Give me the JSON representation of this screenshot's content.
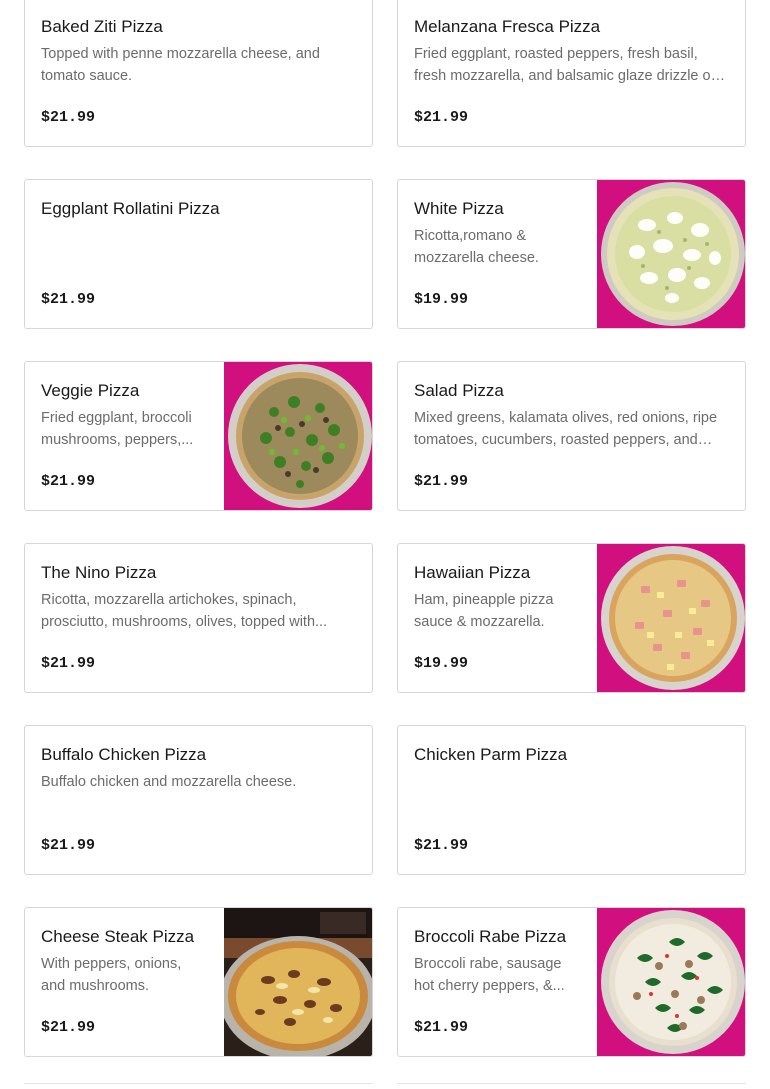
{
  "menu": {
    "items": [
      {
        "name": "Baked Ziti Pizza",
        "description": "Topped with penne mozzarella cheese, and tomato sauce.",
        "price": "$21.99",
        "image": null
      },
      {
        "name": "Melanzana Fresca Pizza",
        "description": "Fried eggplant, roasted peppers, fresh basil, fresh mozzarella, and balsamic glaze drizzle on a whi...",
        "price": "$21.99",
        "image": null
      },
      {
        "name": "Eggplant Rollatini Pizza",
        "description": "",
        "price": "$21.99",
        "image": null
      },
      {
        "name": "White Pizza",
        "description": "Ricotta,romano & mozzarella cheese.",
        "price": "$19.99",
        "image": "white-pizza"
      },
      {
        "name": "Veggie Pizza",
        "description": "Fried eggplant, broccoli mushrooms, peppers,...",
        "price": "$21.99",
        "image": "veggie-pizza"
      },
      {
        "name": "Salad Pizza",
        "description": "Mixed greens, kalamata olives, red onions, ripe tomatoes, cucumbers, roasted peppers, and fre...",
        "price": "$21.99",
        "image": null
      },
      {
        "name": "The Nino Pizza",
        "description": "Ricotta, mozzarella artichokes, spinach, prosciutto, mushrooms, olives, topped with...",
        "price": "$21.99",
        "image": null
      },
      {
        "name": "Hawaiian Pizza",
        "description": "Ham, pineapple pizza sauce & mozzarella.",
        "price": "$19.99",
        "image": "hawaiian-pizza"
      },
      {
        "name": "Buffalo Chicken Pizza",
        "description": "Buffalo chicken and mozzarella cheese.",
        "price": "$21.99",
        "image": null
      },
      {
        "name": "Chicken Parm Pizza",
        "description": "",
        "price": "$21.99",
        "image": null
      },
      {
        "name": "Cheese Steak Pizza",
        "description": "With peppers, onions, and mushrooms.",
        "price": "$21.99",
        "image": "cheese-steak-pizza"
      },
      {
        "name": "Broccoli Rabe Pizza",
        "description": "Broccoli rabe, sausage hot cherry peppers, &...",
        "price": "$21.99",
        "image": "broccoli-rabe-pizza"
      }
    ]
  },
  "colors": {
    "photo_background": "#d10f7f",
    "border": "#d6d6d6",
    "title_text": "#191919",
    "description_text": "#6b6b6b"
  }
}
